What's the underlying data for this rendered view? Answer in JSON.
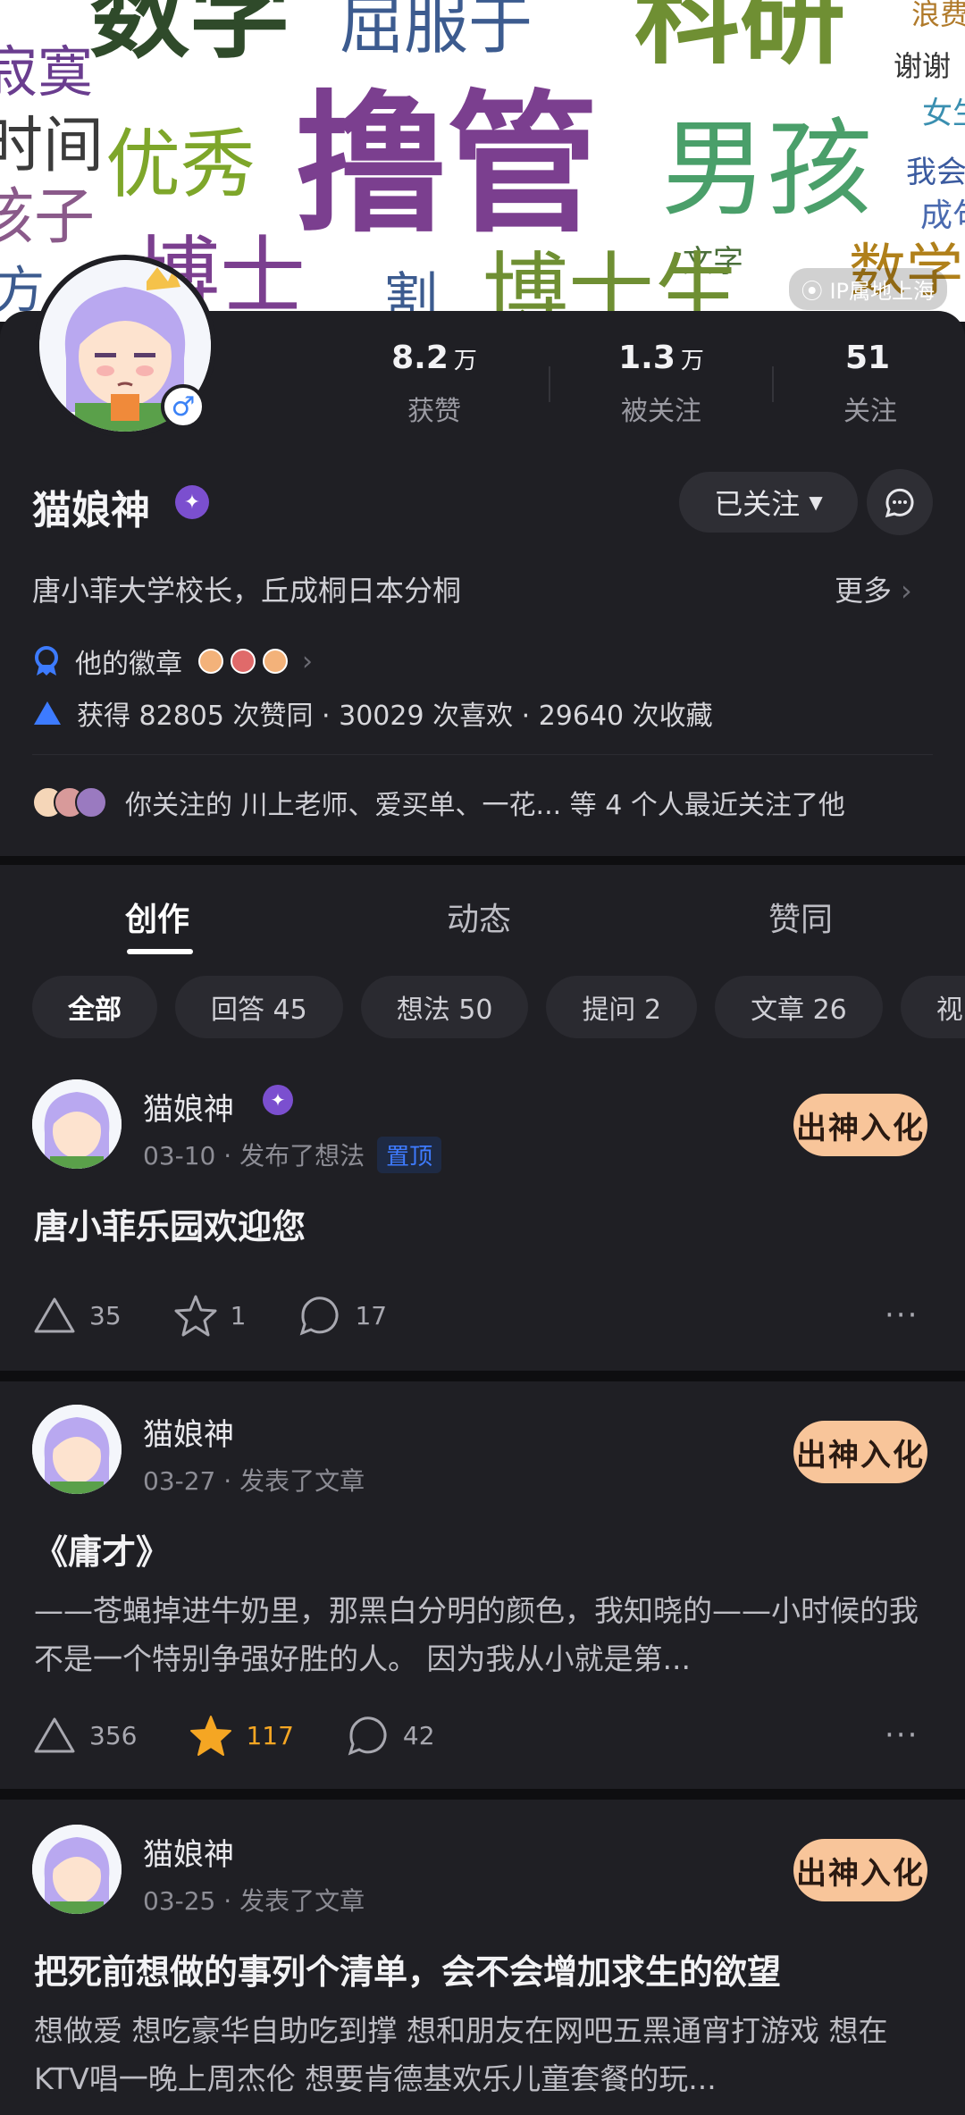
{
  "banner": {
    "words": [
      {
        "text": "数学",
        "color": "#2f4a2a"
      },
      {
        "text": "屈服于",
        "color": "#3c5b8f"
      },
      {
        "text": "科研",
        "color": "#6f8f33"
      },
      {
        "text": "浪费",
        "color": "#b07a2a"
      },
      {
        "text": "寂寞",
        "color": "#6a3d8f"
      },
      {
        "text": "谢谢",
        "color": "#333333"
      },
      {
        "text": "女生",
        "color": "#3a8fb0"
      },
      {
        "text": "时间",
        "color": "#3b3b3b"
      },
      {
        "text": "优秀",
        "color": "#7ea62a"
      },
      {
        "text": "撸管",
        "color": "#7b3f8f"
      },
      {
        "text": "男孩",
        "color": "#4a9f6a"
      },
      {
        "text": "我会",
        "color": "#3a5a9f"
      },
      {
        "text": "孩子",
        "color": "#8a5a8a"
      },
      {
        "text": "成句",
        "color": "#4a6aaf"
      },
      {
        "text": "博士",
        "color": "#7b3f8f"
      },
      {
        "text": "文字",
        "color": "#4a6f3a"
      },
      {
        "text": "数学",
        "color": "#b0801a"
      },
      {
        "text": "方",
        "color": "#3c5b8f"
      },
      {
        "text": "割",
        "color": "#3c5b8f"
      },
      {
        "text": "博士生",
        "color": "#6f8f33"
      }
    ],
    "ip_label": "IP属地上海"
  },
  "profile": {
    "name": "猫娘神",
    "gender_symbol": "♂",
    "stats": [
      {
        "value": "8.2",
        "unit": "万",
        "label": "获赞"
      },
      {
        "value": "1.3",
        "unit": "万",
        "label": "被关注"
      },
      {
        "value": "51",
        "unit": "",
        "label": "关注"
      }
    ],
    "follow_label": "已关注",
    "bio": "唐小菲大学校长，丘成桐日本分桐",
    "more_label": "更多",
    "badges_label": "他的徽章",
    "achievement": "获得 82805 次赞同 · 30029 次喜欢 · 29640 次收藏",
    "mutual_follow": "你关注的 川上老师、爱买单、一花... 等 4 个人最近关注了他"
  },
  "tabs": [
    "创作",
    "动态",
    "赞同"
  ],
  "chips": [
    "全部",
    "回答 45",
    "想法 50",
    "提问 2",
    "文章 26",
    "视"
  ],
  "posts": [
    {
      "author": "猫娘神",
      "meta": "03-10 · 发布了想法",
      "pin": "置顶",
      "sticker": "出神入化",
      "title": "唐小菲乐园欢迎您",
      "body": "",
      "upvotes": "35",
      "stars": "1",
      "comments": "17"
    },
    {
      "author": "猫娘神",
      "meta": "03-27 · 发表了文章",
      "sticker": "出神入化",
      "title": "《庸才》",
      "body": "——苍蝇掉进牛奶里，那黑白分明的颜色，我知晓的——小时候的我不是一个特别争强好胜的人。 因为我从小就是第...",
      "upvotes": "356",
      "stars": "117",
      "comments": "42"
    },
    {
      "author": "猫娘神",
      "meta": "03-25 · 发表了文章",
      "sticker": "出神入化",
      "title": "把死前想做的事列个清单，会不会增加求生的欲望",
      "body": "想做爱 想吃豪华自助吃到撑 想和朋友在网吧五黑通宵打游戏 想在KTV唱一晚上周杰伦 想要肯德基欢乐儿童套餐的玩..."
    }
  ]
}
